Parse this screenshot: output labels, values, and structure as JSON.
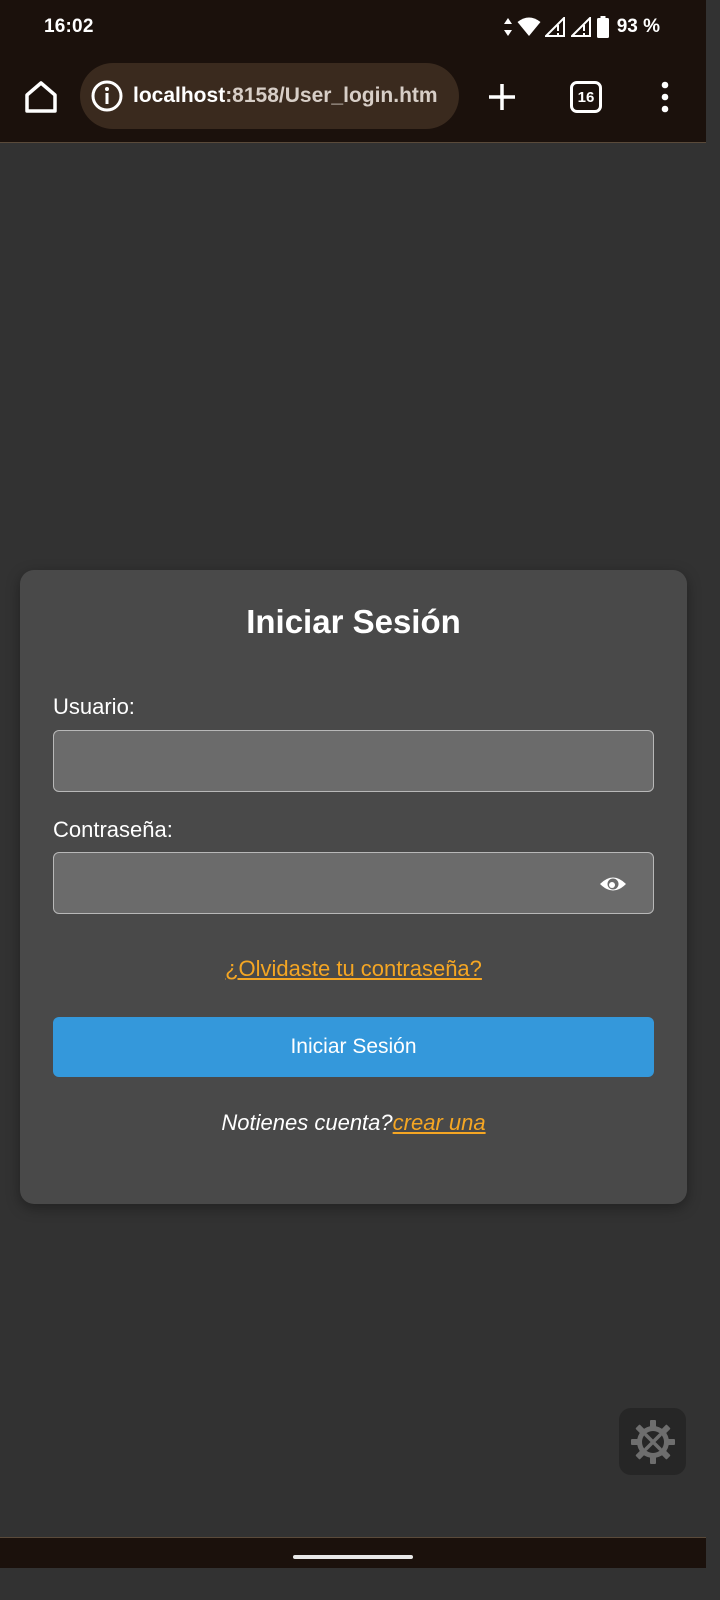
{
  "status_bar": {
    "time": "16:02",
    "battery_percent": "93 %"
  },
  "browser": {
    "url_host": "localhost",
    "url_rest": ":8158/User_login.htm",
    "tab_count": "16"
  },
  "login": {
    "title": "Iniciar Sesión",
    "username_label": "Usuario:",
    "username_value": "",
    "password_label": "Contraseña:",
    "password_value": "",
    "forgot_link": "¿Olvidaste tu contraseña?",
    "submit_label": "Iniciar Sesión",
    "no_account_text": "Notienes cuenta?",
    "create_link": "crear una"
  },
  "colors": {
    "page_bg": "#323232",
    "card_bg": "#494949",
    "accent_link": "#f5a623",
    "button_bg": "#3498db",
    "browser_chrome": "#1b110c"
  },
  "icons": {
    "home": "home-icon",
    "info": "info-icon",
    "new_tab": "plus-icon",
    "menu": "more-vert-icon",
    "eye": "eye-icon",
    "tools": "tools-gear-icon"
  }
}
